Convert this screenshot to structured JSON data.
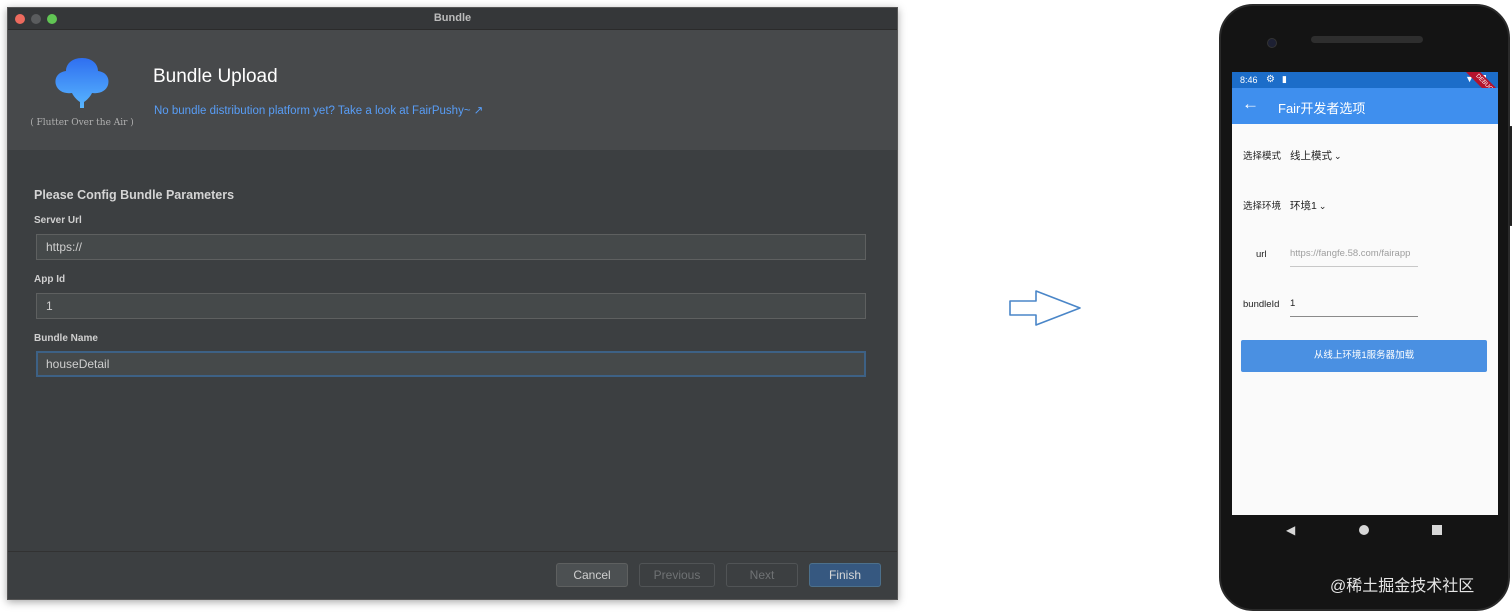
{
  "dialog": {
    "window_title": "Bundle",
    "logo_caption": "( Flutter Over the Air )",
    "title": "Bundle Upload",
    "link_text": "No bundle distribution platform yet? Take a look at FairPushy~ ↗",
    "section_title": "Please Config Bundle Parameters",
    "fields": [
      {
        "label": "Server Url",
        "value": "https://"
      },
      {
        "label": "App Id",
        "value": "1"
      },
      {
        "label": "Bundle Name",
        "value": "houseDetail"
      }
    ],
    "buttons": {
      "cancel": "Cancel",
      "previous": "Previous",
      "next": "Next",
      "finish": "Finish"
    },
    "colors": {
      "link": "#589df6",
      "primary_button": "#365880",
      "logo": "#3d7ff2"
    }
  },
  "phone": {
    "status_time": "8:46",
    "debug_banner": "DEBUG",
    "appbar_title": "Fair开发者选项",
    "rows": {
      "mode_label": "选择模式",
      "mode_value": "线上模式",
      "env_label": "选择环境",
      "env_value": "环境1",
      "url_label": "url",
      "url_value": "https://fangfe.58.com/fairapp",
      "bundle_label": "bundleId",
      "bundle_value": "1"
    },
    "load_button": "从线上环境1服务器加载",
    "colors": {
      "appbar": "#3f8fee",
      "statusbar": "#1c6dc9",
      "button": "#4a90e2"
    }
  },
  "watermark": "@稀土掘金技术社区"
}
